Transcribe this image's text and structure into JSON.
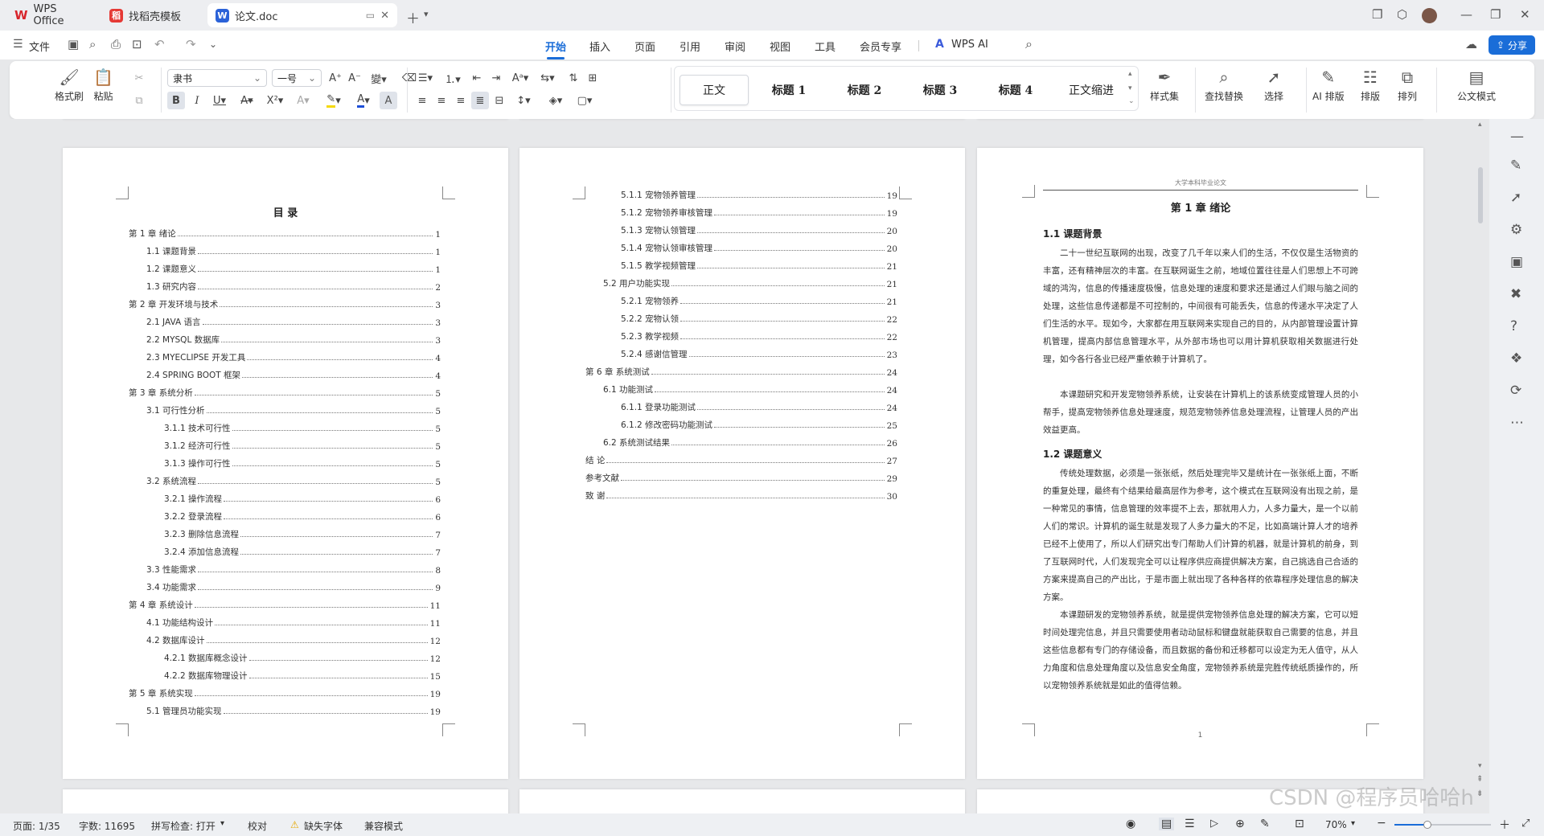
{
  "titlebar": {
    "tabs": [
      {
        "label": "WPS Office",
        "icon": "wps-logo-icon"
      },
      {
        "label": "找稻壳模板",
        "icon": "docer-icon"
      },
      {
        "label": "论文.doc",
        "icon": "word-doc-icon"
      }
    ]
  },
  "menubar": {
    "file": "文件",
    "tabs": [
      "开始",
      "插入",
      "页面",
      "引用",
      "审阅",
      "视图",
      "工具",
      "会员专享"
    ],
    "ai": "WPS AI",
    "share": "分享"
  },
  "ribbon": {
    "format_painter": "格式刷",
    "paste": "粘贴",
    "font_name": "隶书",
    "font_size": "一号",
    "styles": [
      "正文",
      "标题 1",
      "标题 2",
      "标题 3",
      "标题 4",
      "正文缩进"
    ],
    "style_set": "样式集",
    "find_replace": "查找替换",
    "select": "选择",
    "ai_layout": "AI 排版",
    "layout": "排版",
    "arrange": "排列",
    "official": "公文模式"
  },
  "page1": {
    "title": "目  录",
    "toc": [
      {
        "t": "第 1 章  绪论",
        "p": "1",
        "lvl": 0
      },
      {
        "t": "1.1  课题背景",
        "p": "1",
        "lvl": 1
      },
      {
        "t": "1.2  课题意义",
        "p": "1",
        "lvl": 1
      },
      {
        "t": "1.3  研究内容",
        "p": "2",
        "lvl": 1
      },
      {
        "t": "第 2 章  开发环境与技术",
        "p": "3",
        "lvl": 0
      },
      {
        "t": "2.1 JAVA 语言",
        "p": "3",
        "lvl": 1
      },
      {
        "t": "2.2 MYSQL 数据库",
        "p": "3",
        "lvl": 1
      },
      {
        "t": "2.3 MYECLIPSE 开发工具",
        "p": "4",
        "lvl": 1
      },
      {
        "t": "2.4 SPRING BOOT 框架",
        "p": "4",
        "lvl": 1
      },
      {
        "t": "第 3 章  系统分析",
        "p": "5",
        "lvl": 0
      },
      {
        "t": "3.1  可行性分析",
        "p": "5",
        "lvl": 1
      },
      {
        "t": "3.1.1  技术可行性",
        "p": "5",
        "lvl": 2
      },
      {
        "t": "3.1.2  经济可行性",
        "p": "5",
        "lvl": 2
      },
      {
        "t": "3.1.3  操作可行性",
        "p": "5",
        "lvl": 2
      },
      {
        "t": "3.2  系统流程",
        "p": "5",
        "lvl": 1
      },
      {
        "t": "3.2.1  操作流程",
        "p": "6",
        "lvl": 2
      },
      {
        "t": "3.2.2  登录流程",
        "p": "6",
        "lvl": 2
      },
      {
        "t": "3.2.3  删除信息流程",
        "p": "7",
        "lvl": 2
      },
      {
        "t": "3.2.4  添加信息流程",
        "p": "7",
        "lvl": 2
      },
      {
        "t": "3.3  性能需求",
        "p": "8",
        "lvl": 1
      },
      {
        "t": "3.4  功能需求",
        "p": "9",
        "lvl": 1
      },
      {
        "t": "第 4 章  系统设计",
        "p": "11",
        "lvl": 0
      },
      {
        "t": "4.1  功能结构设计",
        "p": "11",
        "lvl": 1
      },
      {
        "t": "4.2  数据库设计",
        "p": "12",
        "lvl": 1
      },
      {
        "t": "4.2.1  数据库概念设计",
        "p": "12",
        "lvl": 2
      },
      {
        "t": "4.2.2  数据库物理设计",
        "p": "15",
        "lvl": 2
      },
      {
        "t": "第 5 章  系统实现",
        "p": "19",
        "lvl": 0
      },
      {
        "t": "5.1  管理员功能实现",
        "p": "19",
        "lvl": 1
      }
    ]
  },
  "page2": {
    "toc": [
      {
        "t": "5.1.1  宠物领养管理",
        "p": "19",
        "lvl": 2
      },
      {
        "t": "5.1.2  宠物领养审核管理",
        "p": "19",
        "lvl": 2
      },
      {
        "t": "5.1.3  宠物认领管理",
        "p": "20",
        "lvl": 2
      },
      {
        "t": "5.1.4  宠物认领审核管理",
        "p": "20",
        "lvl": 2
      },
      {
        "t": "5.1.5  教学视频管理",
        "p": "21",
        "lvl": 2
      },
      {
        "t": "5.2  用户功能实现",
        "p": "21",
        "lvl": 1
      },
      {
        "t": "5.2.1  宠物领养",
        "p": "21",
        "lvl": 2
      },
      {
        "t": "5.2.2  宠物认领",
        "p": "22",
        "lvl": 2
      },
      {
        "t": "5.2.3  教学视频",
        "p": "22",
        "lvl": 2
      },
      {
        "t": "5.2.4  感谢信管理",
        "p": "23",
        "lvl": 2
      },
      {
        "t": "第 6 章  系统测试",
        "p": "24",
        "lvl": 0
      },
      {
        "t": "6.1  功能测试",
        "p": "24",
        "lvl": 1
      },
      {
        "t": "6.1.1  登录功能测试",
        "p": "24",
        "lvl": 2
      },
      {
        "t": "6.1.2  修改密码功能测试",
        "p": "25",
        "lvl": 2
      },
      {
        "t": "6.2  系统测试结果",
        "p": "26",
        "lvl": 1
      },
      {
        "t": "结   论",
        "p": "27",
        "lvl": 0
      },
      {
        "t": "参考文献",
        "p": "29",
        "lvl": 0
      },
      {
        "t": "致   谢",
        "p": "30",
        "lvl": 0
      }
    ]
  },
  "page3": {
    "header": "大学本科毕业论文",
    "chapter": "第 1 章  绪论",
    "s1": "1.1  课题背景",
    "p1": "二十一世纪互联网的出现，改变了几千年以来人们的生活，不仅仅是生活物资的丰富，还有精神层次的丰富。在互联网诞生之前，地域位置往往是人们思想上不可跨域的鸿沟，信息的传播速度极慢，信息处理的速度和要求还是通过人们眼与脑之间的处理，这些信息传递都是不可控制的，中间很有可能丢失，信息的传递水平决定了人们生活的水平。现如今，大家都在用互联网来实现自己的目的，从内部管理设置计算机管理，提高内部信息管理水平，从外部市场也可以用计算机获取相关数据进行处理，如今各行各业已经严重依赖于计算机了。",
    "p2": "本课题研究和开发宠物领养系统，让安装在计算机上的该系统变成管理人员的小帮手，提高宠物领养信息处理速度，规范宠物领养信息处理流程，让管理人员的产出效益更高。",
    "s2": "1.2  课题意义",
    "p3": "传统处理数据，必须是一张张纸，然后处理完毕又是统计在一张张纸上面，不断的重复处理，最终有个结果给最高层作为参考，这个模式在互联网没有出现之前，是一种常见的事情，信息管理的效率提不上去，那就用人力，人多力量大，是一个以前人们的常识。计算机的诞生就是发现了人多力量大的不足，比如高端计算人才的培养已经不上使用了，所以人们研究出专门帮助人们计算的机器，就是计算机的前身，到了互联网时代，人们发现完全可以让程序供应商提供解决方案，自己挑选自己合适的方案来提高自己的产出比，于是市面上就出现了各种各样的依靠程序处理信息的解决方案。",
    "p4": "本课题研发的宠物领养系统，就是提供宠物领养信息处理的解决方案，它可以短时间处理完信息，并且只需要使用者动动鼠标和键盘就能获取自己需要的信息，并且这些信息都有专门的存储设备，而且数据的备份和迁移都可以设定为无人值守，从人力角度和信息处理角度以及信息安全角度，宠物领养系统是完胜传统纸质操作的，所以宠物领养系统就是如此的值得信赖。",
    "page_no": "1"
  },
  "statusbar": {
    "page": "页面: 1/35",
    "words": "字数: 11695",
    "spell": "拼写检查: 打开",
    "proof": "校对",
    "missing_font": "缺失字体",
    "compat": "兼容模式",
    "zoom": "70%"
  },
  "watermark": "CSDN @程序员哈哈h"
}
